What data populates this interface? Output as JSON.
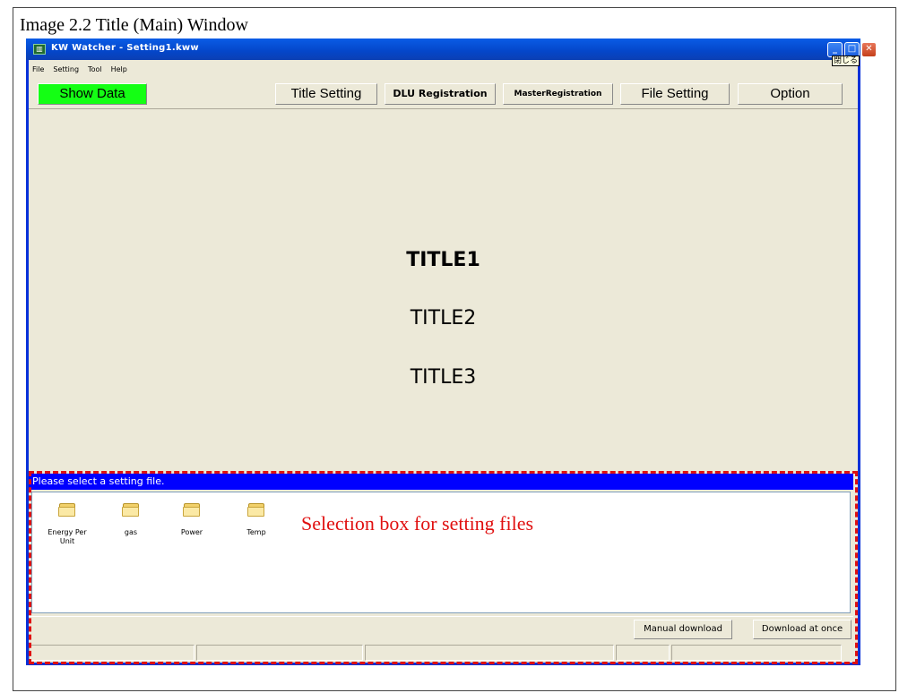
{
  "caption": "Image 2.2 Title (Main) Window",
  "window": {
    "title": "KW Watcher - Setting1.kww",
    "icon": "app-icon",
    "close_tooltip": "閉じる",
    "controls": {
      "minimize": "minimize-icon",
      "maximize": "maximize-icon",
      "close": "close-icon"
    }
  },
  "menu": {
    "items": [
      {
        "label": "File"
      },
      {
        "label": "Setting"
      },
      {
        "label": "Tool"
      },
      {
        "label": "Help"
      }
    ]
  },
  "toolbar": {
    "show_data": "Show Data",
    "title_setting": "Title Setting",
    "dlu_registration": "DLU Registration",
    "master_registration": "MasterRegistration",
    "file_setting": "File Setting",
    "option": "Option"
  },
  "titles": {
    "title1": "TITLE1",
    "title2": "TITLE2",
    "title3": "TITLE3"
  },
  "file_selection": {
    "header": "Please select a setting file.",
    "folders": [
      {
        "name": "Energy Per Unit",
        "icon": "folder-icon"
      },
      {
        "name": "gas",
        "icon": "folder-icon"
      },
      {
        "name": "Power",
        "icon": "folder-icon"
      },
      {
        "name": "Temp",
        "icon": "folder-icon"
      }
    ],
    "annotation": "Selection box for setting files"
  },
  "actions": {
    "manual_download": "Manual download",
    "download_at_once": "Download at once"
  },
  "colors": {
    "show_data_bg": "#14ff14",
    "header_bg": "#0000ff",
    "annotation": "#e01010",
    "window_bg": "#ece9d8"
  }
}
